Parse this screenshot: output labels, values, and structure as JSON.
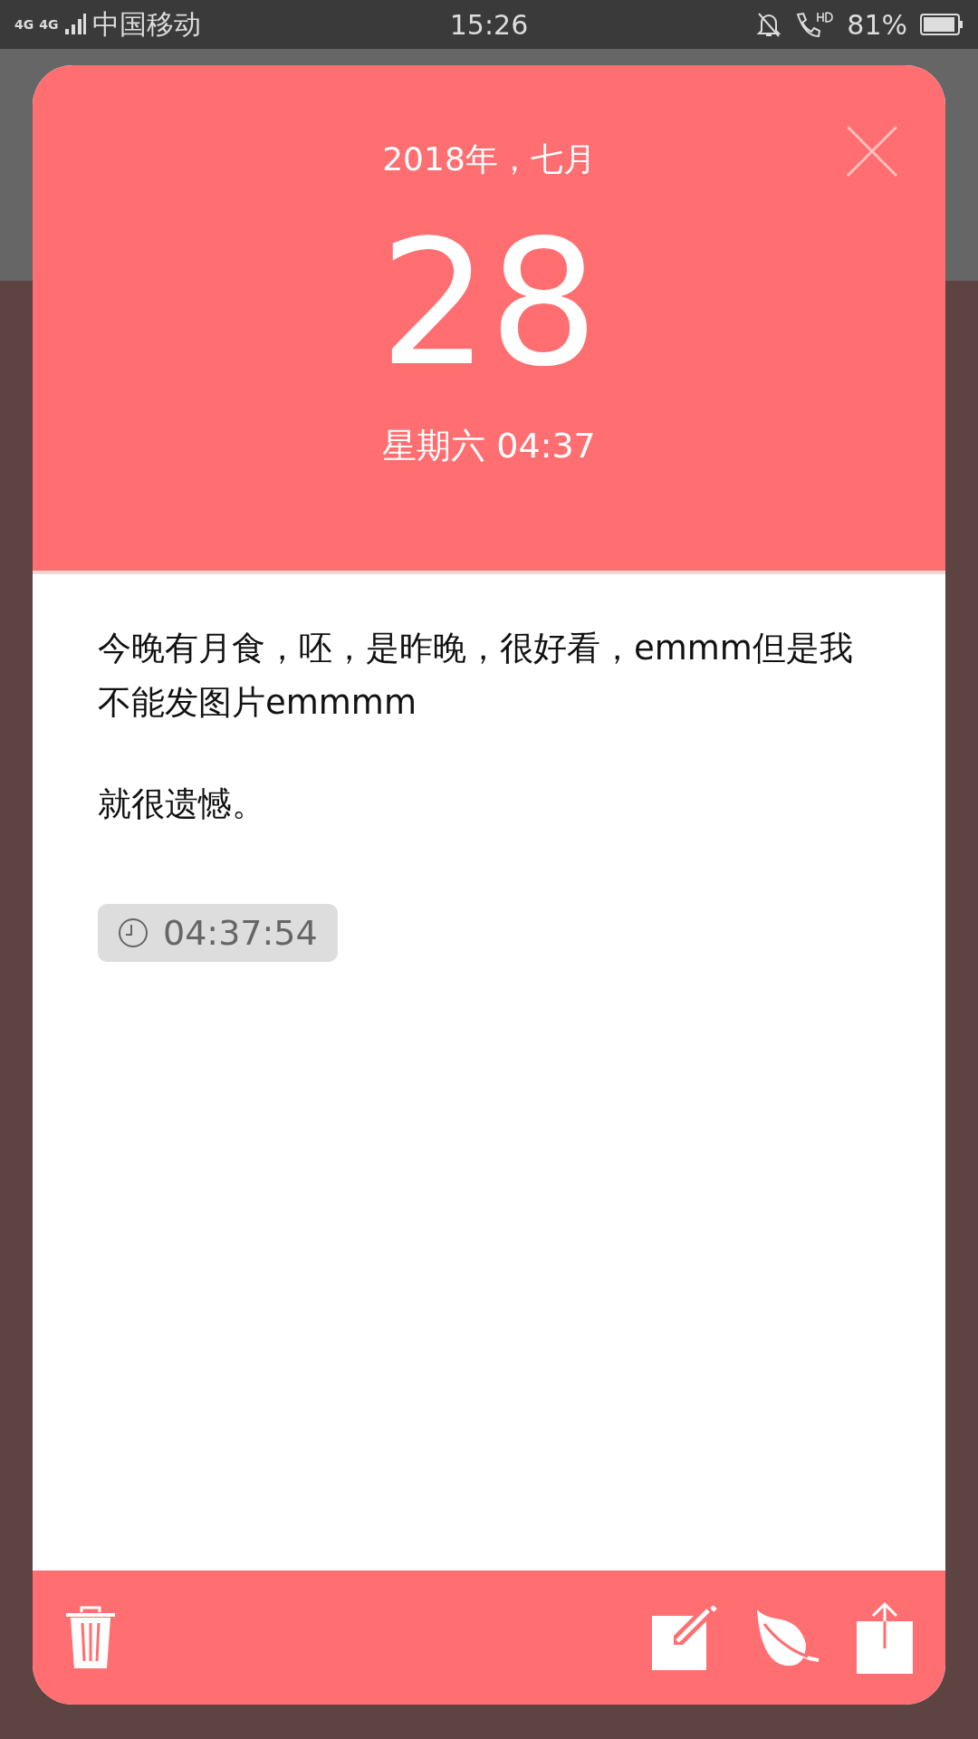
{
  "status_bar": {
    "network_labels": [
      "4G",
      "4G"
    ],
    "carrier": "中国移动",
    "time": "15:26",
    "battery": "81%"
  },
  "note": {
    "year_month": "2018年，七月",
    "day": "28",
    "weekday_time": "星期六 04:37",
    "paragraphs": [
      "今晚有月食，呸，是昨晚，很好看，emmm但是我不能发图片emmmm",
      "就很遗憾。"
    ],
    "timestamp": "04:37:54"
  }
}
